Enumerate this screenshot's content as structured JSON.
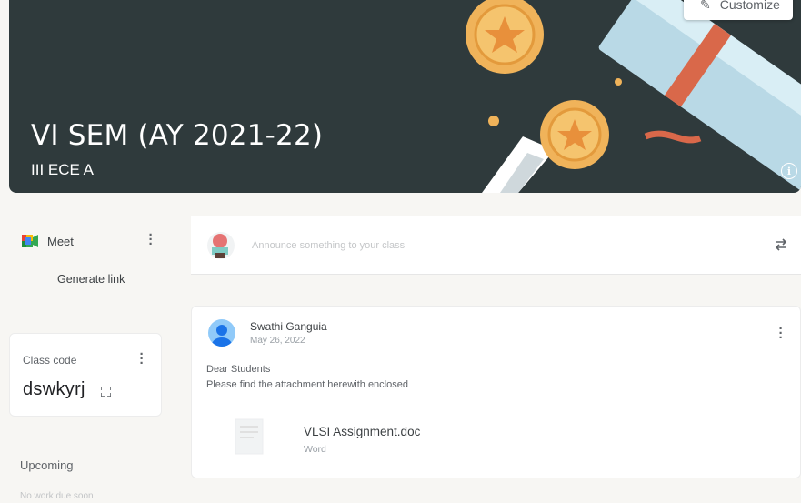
{
  "banner": {
    "title": "VI SEM (AY 2021-22)",
    "subtitle": "III ECE A",
    "customize_label": "Customize",
    "background_color": "#2f3a3c"
  },
  "meet": {
    "label": "Meet",
    "generate_link_label": "Generate link"
  },
  "class_code": {
    "label": "Class code",
    "value": "dswkyrj"
  },
  "upcoming": {
    "title": "Upcoming",
    "note": "No work due soon"
  },
  "announce": {
    "placeholder": "Announce something to your class"
  },
  "post": {
    "author": "Swathi Ganguia",
    "date": "May 26, 2022",
    "body_line_1": "Dear Students",
    "body_line_2": "Please find the attachment herewith enclosed",
    "attachment": {
      "name": "VLSI Assignment.doc",
      "type": "Word"
    }
  },
  "icons": {
    "customize": "pencil-icon",
    "info": "info-icon",
    "meet": "google-meet-icon",
    "menu": "kebab-menu-icon",
    "fullscreen": "fullscreen-icon",
    "repost": "repost-icon"
  }
}
